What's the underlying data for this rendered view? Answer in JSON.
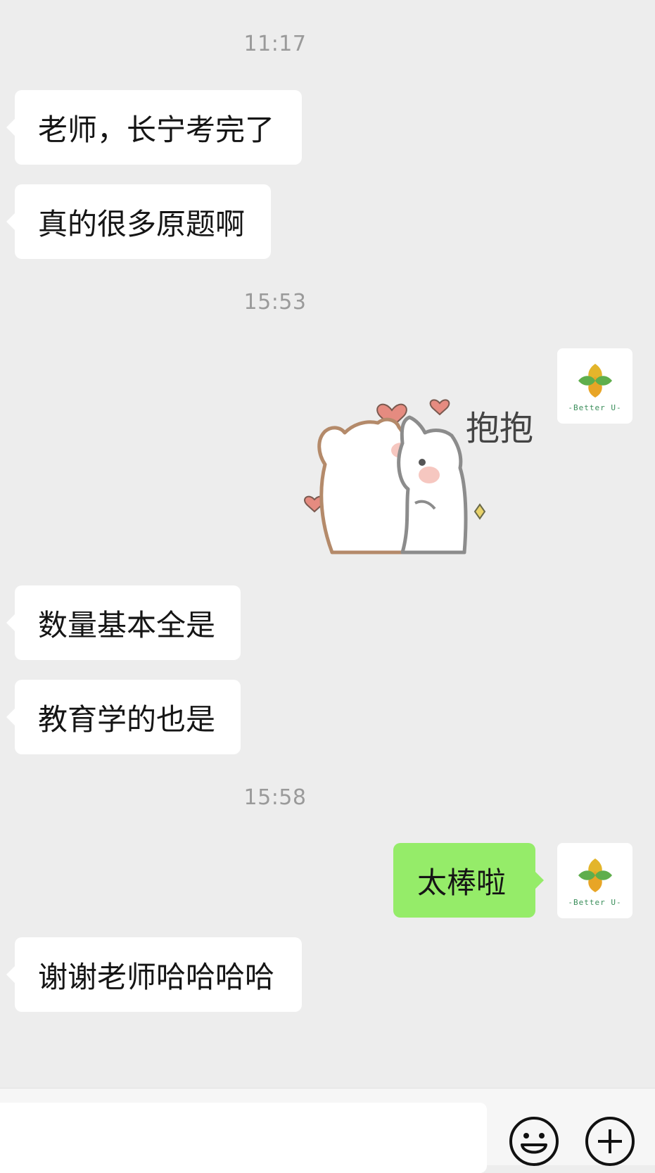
{
  "messages": [
    {
      "type": "time",
      "text": "11:17"
    },
    {
      "type": "in",
      "text": "老师，长宁考完了"
    },
    {
      "type": "in",
      "text": "真的很多原题啊"
    },
    {
      "type": "time",
      "text": "15:53"
    },
    {
      "type": "out_sticker",
      "sticker_text": "抱抱"
    },
    {
      "type": "in",
      "text": "数量基本全是"
    },
    {
      "type": "in",
      "text": "教育学的也是"
    },
    {
      "type": "time",
      "text": "15:58"
    },
    {
      "type": "out",
      "text": "太棒啦"
    },
    {
      "type": "in",
      "text": "谢谢老师哈哈哈哈"
    }
  ],
  "self_avatar": {
    "text": "-Better U-"
  },
  "input_bar": {
    "emoji_icon": "smiley-face-icon",
    "plus_icon": "plus-circle-icon"
  },
  "colors": {
    "background": "#ededed",
    "incoming_bubble": "#ffffff",
    "outgoing_bubble": "#95ec69",
    "timestamp": "#9a9a9a"
  }
}
